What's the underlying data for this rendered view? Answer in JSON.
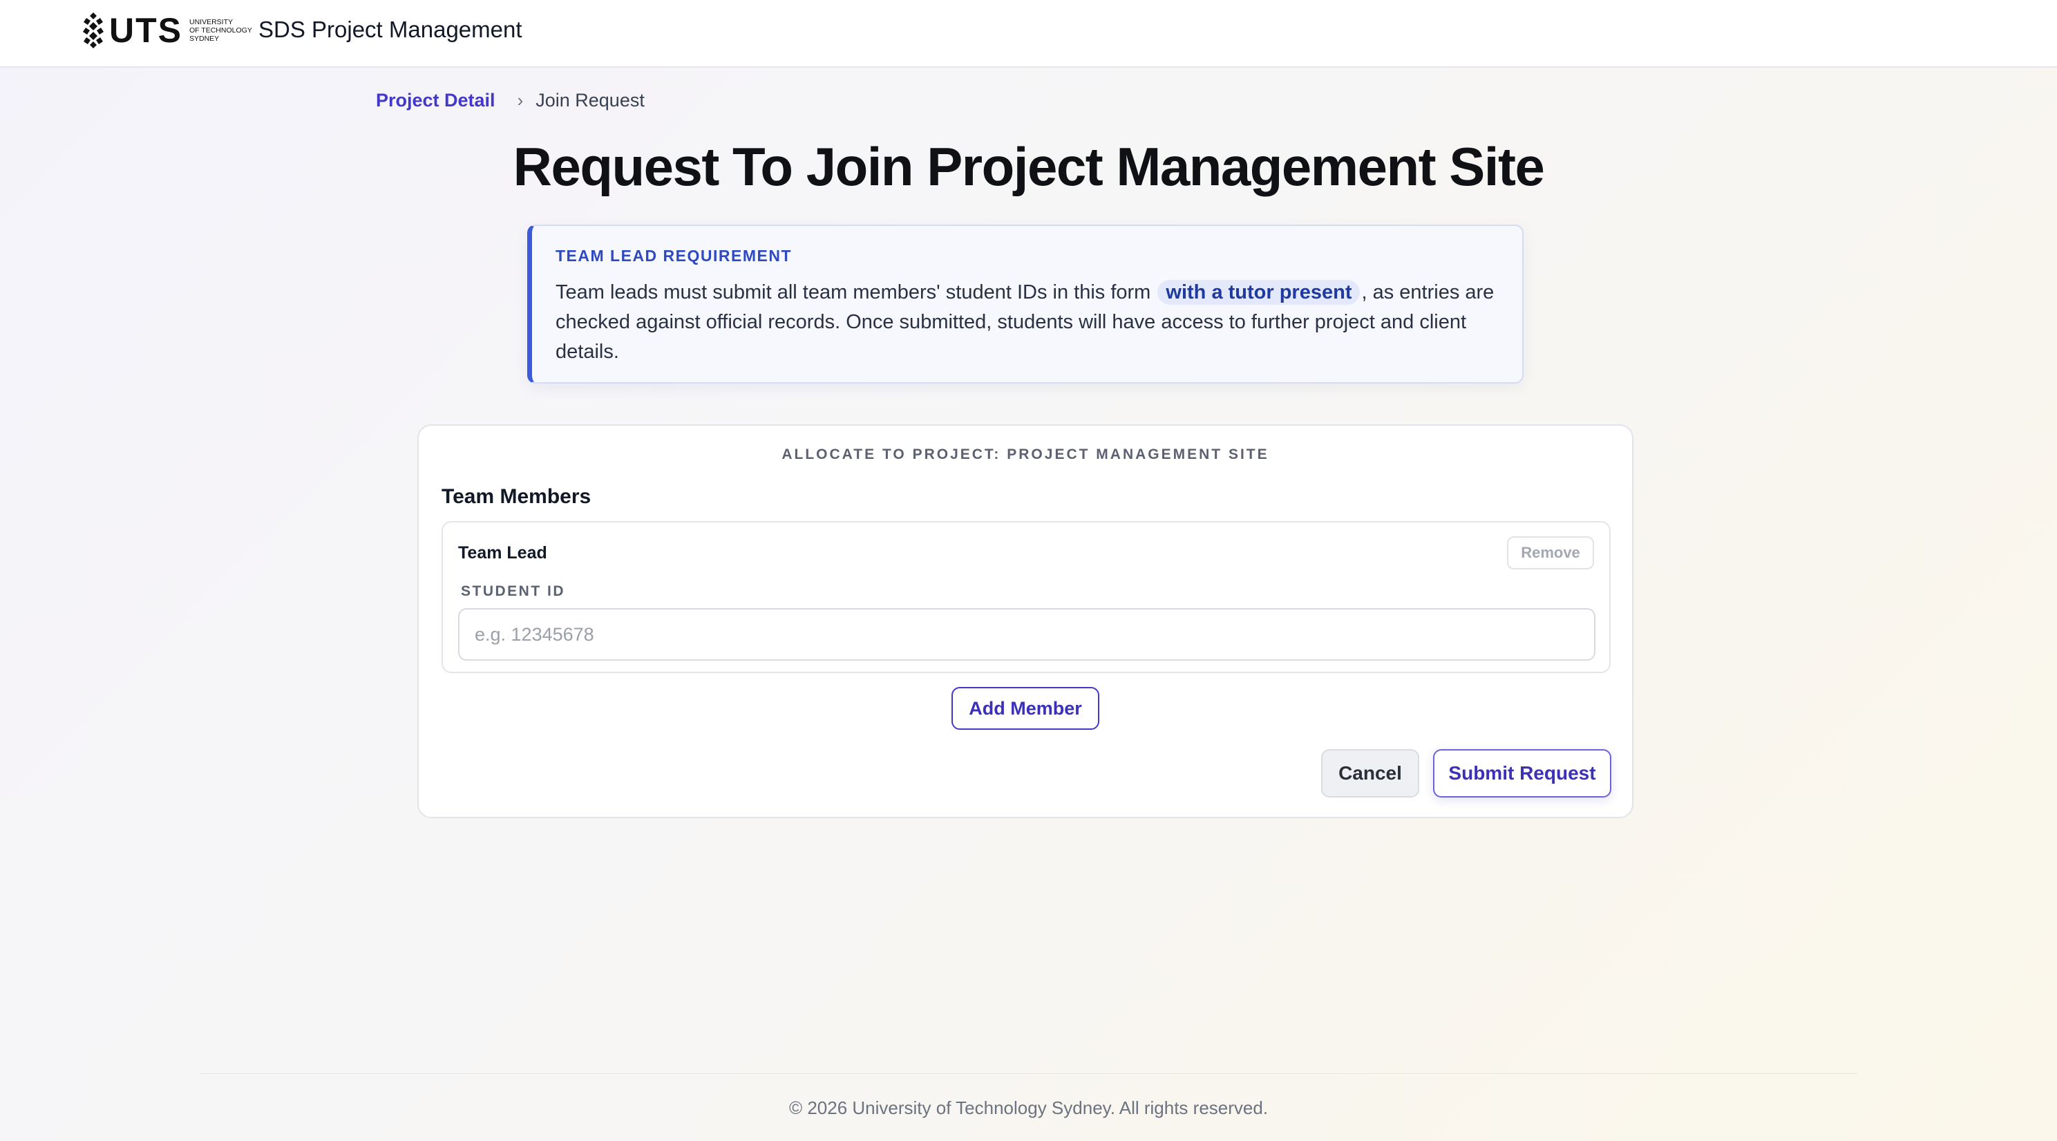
{
  "header": {
    "logo_text": "UTS",
    "logo_subtitle": [
      "UNIVERSITY",
      "OF TECHNOLOGY",
      "SYDNEY"
    ],
    "app_title": "SDS Project Management"
  },
  "breadcrumb": {
    "link_label": "Project Detail",
    "separator": "›",
    "current": "Join Request"
  },
  "page_title": "Request To Join Project Management Site",
  "notice": {
    "heading": "TEAM LEAD REQUIREMENT",
    "body_before": "Team leads must submit all team members' student IDs in this form",
    "highlight": "with a tutor present",
    "body_after": ", as entries are checked against official records. Once submitted, students will have access to further project and client details."
  },
  "card": {
    "allocate_label": "ALLOCATE TO PROJECT: PROJECT MANAGEMENT SITE",
    "section_title": "Team Members",
    "members": [
      {
        "role": "Team Lead",
        "remove_label": "Remove",
        "field_label": "STUDENT ID",
        "value": "",
        "placeholder": "e.g. 12345678"
      }
    ],
    "add_member_label": "Add Member",
    "cancel_label": "Cancel",
    "submit_label": "Submit Request"
  },
  "footer": {
    "text": "© 2026 University of Technology Sydney. All rights reserved."
  },
  "colors": {
    "accent": "#4338ca",
    "notice_border": "#3b5bdb",
    "notice_heading": "#2f4ac1"
  }
}
